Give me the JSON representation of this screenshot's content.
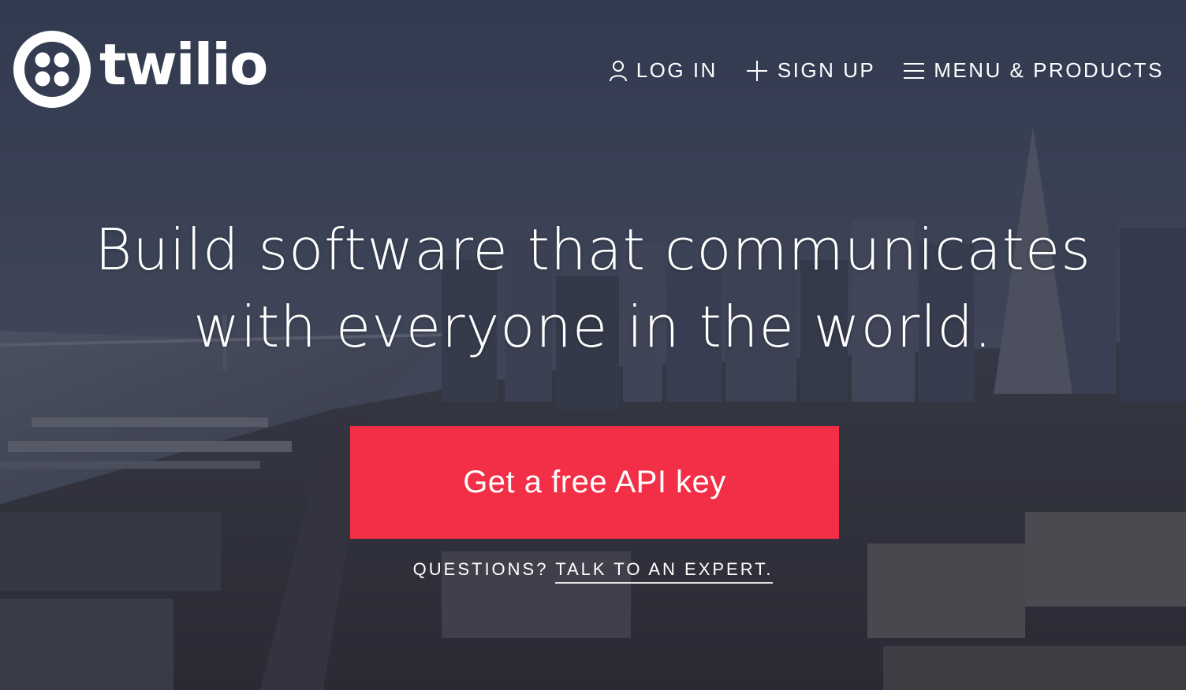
{
  "brand": {
    "name": "twilio",
    "accent": "#f22f46"
  },
  "nav": {
    "login": {
      "icon": "user-icon",
      "label": "LOG IN"
    },
    "signup": {
      "icon": "plus-icon",
      "label": "SIGN UP"
    },
    "menu": {
      "icon": "hamburger-icon",
      "label": "MENU & PRODUCTS"
    }
  },
  "hero": {
    "headline_line1": "Build software that communicates",
    "headline_line2": "with everyone in the world.",
    "cta_label": "Get a free API key",
    "questions_prefix": "QUESTIONS?",
    "expert_link": "TALK TO AN EXPERT",
    "questions_suffix": "."
  }
}
